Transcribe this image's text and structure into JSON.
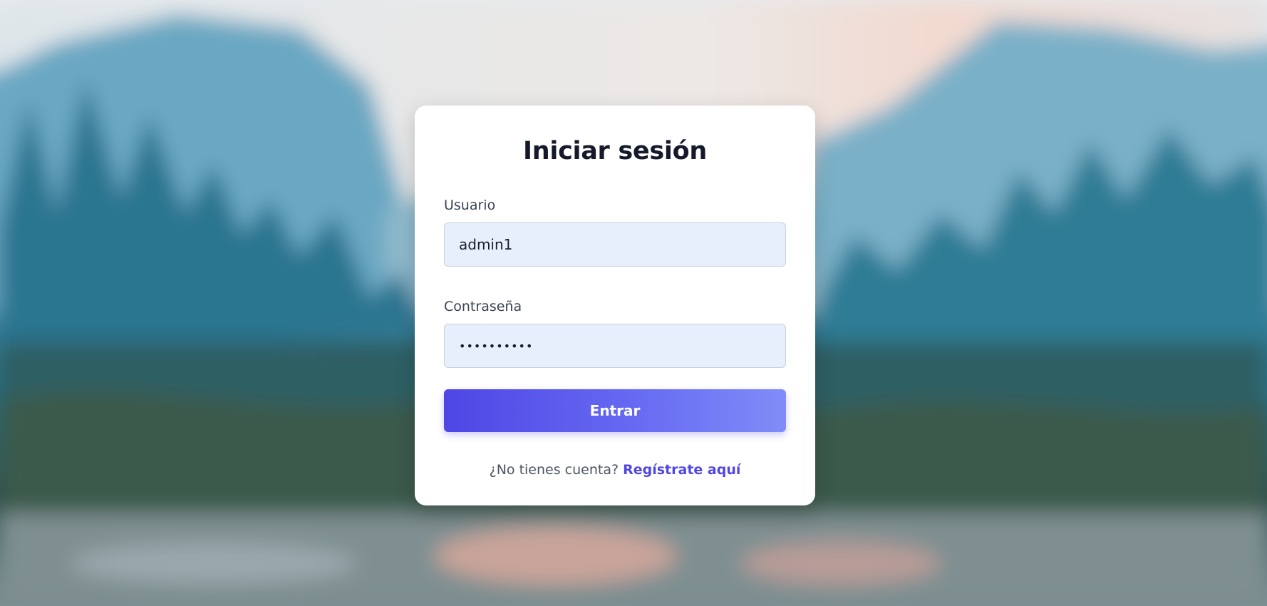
{
  "login": {
    "title": "Iniciar sesión",
    "username_label": "Usuario",
    "username_value": "admin1",
    "password_label": "Contraseña",
    "password_value": "••••••••••",
    "submit_label": "Entrar",
    "footer_text": "¿No tienes cuenta?",
    "register_link": "Regístrate aquí"
  },
  "colors": {
    "accent": "#4f46e5",
    "button_gradient_end": "#818cf8",
    "title": "#141a2a",
    "input_background": "#e8effc"
  }
}
